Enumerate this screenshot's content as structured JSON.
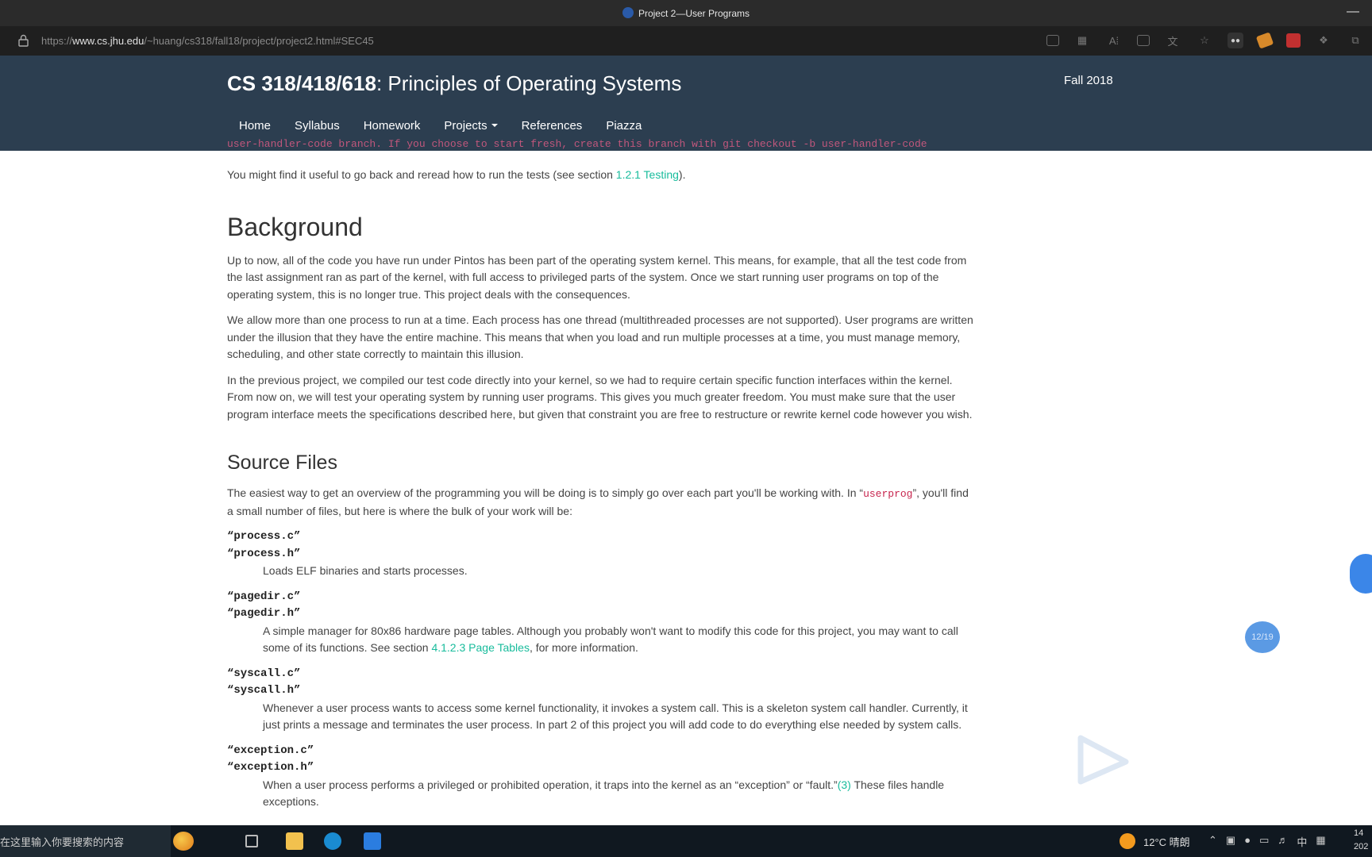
{
  "browser": {
    "window_title": "Project 2—User Programs",
    "url_prefix": "https://",
    "url_host": "www.cs.jhu.edu",
    "url_path": "/~huang/cs318/fall18/project/project2.html#SEC45",
    "minimize_glyph": "—",
    "toolbar_icons": [
      "reader-view-icon",
      "immersive-icon",
      "read-aloud-icon",
      "split-screen-icon",
      "translate-icon",
      "favorite-icon",
      "extension-icon",
      "extension-icon-2",
      "extension-icon-3",
      "extensions-icon",
      "collections-icon"
    ]
  },
  "site": {
    "course_code": "CS 318/418/618",
    "course_title": ": Principles of Operating Systems",
    "term": "Fall 2018",
    "nav": [
      {
        "label": "Home"
      },
      {
        "label": "Syllabus"
      },
      {
        "label": "Homework"
      },
      {
        "label": "Projects"
      },
      {
        "label": "References"
      },
      {
        "label": "Piazza"
      }
    ]
  },
  "content": {
    "cutoff_line": "user-handler-code branch. If you choose to start fresh, create this branch with  git checkout -b user-handler-code",
    "testing": {
      "before": "You might find it useful to go back and reread how to run the tests (see section ",
      "link": "1.2.1 Testing",
      "after": ")."
    },
    "background": {
      "heading": "Background",
      "p1": "Up to now, all of the code you have run under Pintos has been part of the operating system kernel. This means, for example, that all the test code from the last assignment ran as part of the kernel, with full access to privileged parts of the system. Once we start running user programs on top of the operating system, this is no longer true. This project deals with the consequences.",
      "p2": "We allow more than one process to run at a time. Each process has one thread (multithreaded processes are not supported). User programs are written under the illusion that they have the entire machine. This means that when you load and run multiple processes at a time, you must manage memory, scheduling, and other state correctly to maintain this illusion.",
      "p3": "In the previous project, we compiled our test code directly into your kernel, so we had to require certain specific function interfaces within the kernel. From now on, we will test your operating system by running user programs. This gives you much greater freedom. You must make sure that the user program interface meets the specifications described here, but given that constraint you are free to restructure or rewrite kernel code however you wish."
    },
    "source_files": {
      "heading": "Source Files",
      "intro_before": "The easiest way to get an overview of the programming you will be doing is to simply go over each part you'll be working with. In “",
      "intro_code": "userprog",
      "intro_after": "”, you'll find a small number of files, but here is where the bulk of your work will be:",
      "files": [
        {
          "names": [
            "“process.c”",
            "“process.h”"
          ],
          "desc": "Loads ELF binaries and starts processes."
        },
        {
          "names": [
            "“pagedir.c”",
            "“pagedir.h”"
          ],
          "desc_before": "A simple manager for 80x86 hardware page tables. Although you probably won't want to modify this code for this project, you may want to call some of its functions. See section ",
          "desc_link": "4.1.2.3 Page Tables",
          "desc_after": ", for more information."
        },
        {
          "names": [
            "“syscall.c”",
            "“syscall.h”"
          ],
          "desc": "Whenever a user process wants to access some kernel functionality, it invokes a system call. This is a skeleton system call handler. Currently, it just prints a message and terminates the user process. In part 2 of this project you will add code to do everything else needed by system calls."
        },
        {
          "names": [
            "“exception.c”",
            "“exception.h”"
          ],
          "desc_before": "When a user process performs a privileged or prohibited operation, it traps into the kernel as an “exception” or “fault.”",
          "desc_link": "(3)",
          "desc_after": " These files handle exceptions."
        }
      ]
    }
  },
  "overlay": {
    "page_counter": "12/19"
  },
  "taskbar": {
    "search_placeholder": "在这里输入你要搜索的内容",
    "weather": "12°C  晴朗",
    "ime": "中",
    "clock_time": "14",
    "clock_date": "202"
  }
}
